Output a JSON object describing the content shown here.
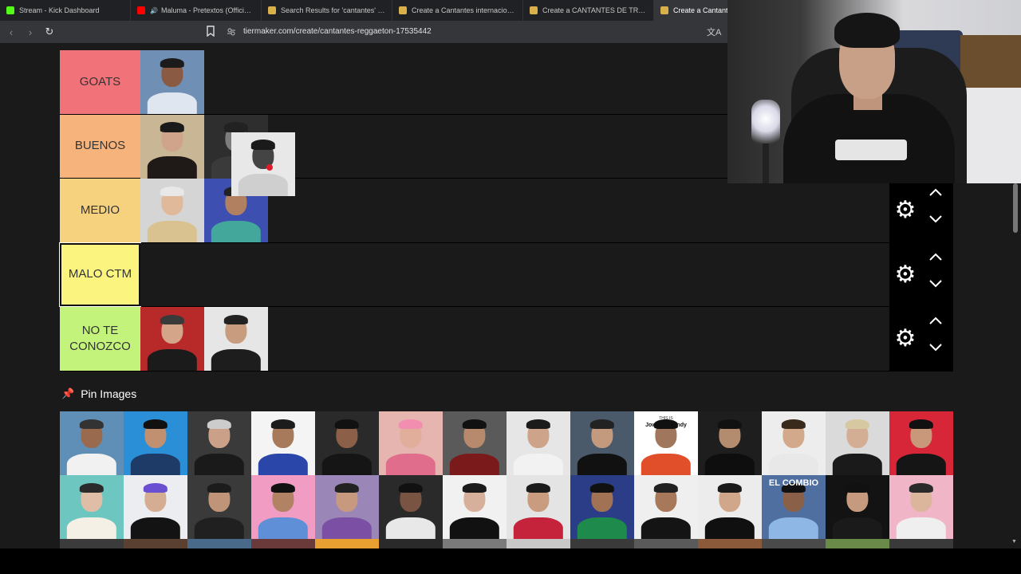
{
  "browser": {
    "tabs": [
      {
        "label": "Stream - Kick Dashboard",
        "icon": "kick-icon",
        "color": "#53fc18",
        "active": false
      },
      {
        "label": "Maluma - Pretextos (Official Audi",
        "icon": "youtube-icon",
        "color": "#ff0000",
        "active": false
      },
      {
        "label": "Search Results for 'cantantes' - TierM",
        "icon": "tiermaker-icon",
        "color": "#d9b04a",
        "active": false
      },
      {
        "label": "Create a Cantantes internacionales Ti",
        "icon": "tiermaker-icon",
        "color": "#d9b04a",
        "active": false
      },
      {
        "label": "Create a CANTANTES DE TRAP Tier L",
        "icon": "tiermaker-icon",
        "color": "#d9b04a",
        "active": false
      },
      {
        "label": "Create a Cantantes",
        "icon": "tiermaker-icon",
        "color": "#d9b04a",
        "active": true
      }
    ],
    "url": "tiermaker.com/create/cantantes-reggaeton-17535442"
  },
  "tiers": [
    {
      "label": "GOATS",
      "color": "#f2727a",
      "selected": false,
      "show_controls": false,
      "items": [
        {
          "name": "artist-thumb",
          "bg": "#6f8fb4",
          "skin": "#8a5a42",
          "shirt": "#dfe6ef",
          "hair": "#1b1b1b"
        }
      ]
    },
    {
      "label": "BUENOS",
      "color": "#f6b47c",
      "selected": false,
      "show_controls": false,
      "items": [
        {
          "name": "artist-thumb",
          "bg": "#c9b694",
          "skin": "#cfa48a",
          "shirt": "#1f1a18",
          "hair": "#1a1a1a"
        },
        {
          "name": "artist-thumb",
          "bg": "#2e2e2e",
          "skin": "#7d7d7d",
          "shirt": "#3a3a3a",
          "hair": "#222"
        }
      ]
    },
    {
      "label": "MEDIO",
      "color": "#f7d27e",
      "selected": false,
      "show_controls": true,
      "items": [
        {
          "name": "artist-thumb",
          "bg": "#d5d5d5",
          "skin": "#e0b89a",
          "shirt": "#d9c290",
          "hair": "#e8e8e8"
        },
        {
          "name": "artist-thumb",
          "bg": "#3d4fb0",
          "skin": "#b08060",
          "shirt": "#44a79c",
          "hair": "#222"
        }
      ]
    },
    {
      "label": "MALO CTM",
      "color": "#fbf57f",
      "selected": true,
      "show_controls": true,
      "items": []
    },
    {
      "label": "NO TE CONOZCO",
      "color": "#c3f37a",
      "selected": false,
      "show_controls": true,
      "items": [
        {
          "name": "artist-thumb",
          "bg": "#b82a2a",
          "skin": "#d4a588",
          "shirt": "#1b1b1b",
          "hair": "#3a3a3a"
        },
        {
          "name": "artist-thumb",
          "bg": "#e6e6e6",
          "skin": "#c89c7e",
          "shirt": "#1d1d1d",
          "hair": "#222"
        }
      ]
    }
  ],
  "pin_images": {
    "title": "Pin Images",
    "items": [
      {
        "bg": "#5f8fb6",
        "skin": "#9a6a4e",
        "shirt": "#f1f1f1",
        "hair": "#333"
      },
      {
        "bg": "#2b8fd8",
        "skin": "#c09070",
        "shirt": "#1d3b66",
        "hair": "#111"
      },
      {
        "bg": "#3a3a3a",
        "skin": "#caa088",
        "shirt": "#1a1a1a",
        "hair": "#ccc"
      },
      {
        "bg": "#f4f4f4",
        "skin": "#a77a5c",
        "shirt": "#2946a8",
        "hair": "#1c1c1c"
      },
      {
        "bg": "#2a2a2a",
        "skin": "#8c6048",
        "shirt": "#151515",
        "hair": "#111"
      },
      {
        "bg": "#e7b5b0",
        "skin": "#e0ae9a",
        "shirt": "#e06d8c",
        "hair": "#f28fb0"
      },
      {
        "bg": "#5a5a5a",
        "skin": "#b78a6e",
        "shirt": "#7a1a1a",
        "hair": "#111"
      },
      {
        "bg": "#e6e6e6",
        "skin": "#cda38a",
        "shirt": "#f2f2f2",
        "hair": "#1b1b1b"
      },
      {
        "bg": "#4a5a6b",
        "skin": "#c49a7e",
        "shirt": "#111111",
        "hair": "#222"
      },
      {
        "bg": "#ffffff",
        "skin": "#a0775c",
        "shirt": "#e14f2a",
        "hair": "#111"
      },
      {
        "bg": "#1e1e1e",
        "skin": "#b38c70",
        "shirt": "#0e0e0e",
        "hair": "#111"
      },
      {
        "bg": "#ededed",
        "skin": "#d3a98c",
        "shirt": "#e8e8e8",
        "hair": "#3a2a1c"
      },
      {
        "bg": "#dadada",
        "skin": "#d4ae94",
        "shirt": "#1a1a1a",
        "hair": "#d6c8a0"
      },
      {
        "bg": "#d62638",
        "skin": "#c9987a",
        "shirt": "#151515",
        "hair": "#111"
      },
      {
        "bg": "#6ec6c0",
        "skin": "#e0bda6",
        "shirt": "#f4f0e6",
        "hair": "#2a2a2a"
      },
      {
        "bg": "#ecedf1",
        "skin": "#d4ad93",
        "shirt": "#131313",
        "hair": "#6a4fd0"
      },
      {
        "bg": "#3a3a3a",
        "skin": "#c09478",
        "shirt": "#202020",
        "hair": "#1c1c1c"
      },
      {
        "bg": "#f19cc2",
        "skin": "#b28264",
        "shirt": "#5f8fd6",
        "hair": "#121212"
      },
      {
        "bg": "#9b86b8",
        "skin": "#c79a80",
        "shirt": "#7b4fa4",
        "hair": "#222"
      },
      {
        "bg": "#2a2a2a",
        "skin": "#7a5442",
        "shirt": "#e8e8e8",
        "hair": "#111"
      },
      {
        "bg": "#f1f1f1",
        "skin": "#d6b09a",
        "shirt": "#111111",
        "hair": "#1b1b1b"
      },
      {
        "bg": "#e4e4e4",
        "skin": "#c99c80",
        "shirt": "#c4233b",
        "hair": "#1b1b1b"
      },
      {
        "bg": "#2b3d86",
        "skin": "#a27254",
        "shirt": "#1e8a4b",
        "hair": "#111"
      },
      {
        "bg": "#efefef",
        "skin": "#a8785a",
        "shirt": "#141414",
        "hair": "#222"
      },
      {
        "bg": "#ececec",
        "skin": "#d1a78c",
        "shirt": "#101010",
        "hair": "#1a1a1a"
      },
      {
        "bg": "#4f6fa0",
        "skin": "#8a6048",
        "shirt": "#8fb7e6",
        "hair": "#111"
      },
      {
        "bg": "#131313",
        "skin": "#c59a7e",
        "shirt": "#1a1a1a",
        "hair": "#111"
      },
      {
        "bg": "#f0b6c8",
        "skin": "#dbb59c",
        "shirt": "#efefef",
        "hair": "#2a2a2a"
      }
    ],
    "overlay_texts": {
      "jowell": "THIS IS",
      "jowell_name": "Jowell & Randy",
      "combio": "EL COMBIO"
    }
  }
}
